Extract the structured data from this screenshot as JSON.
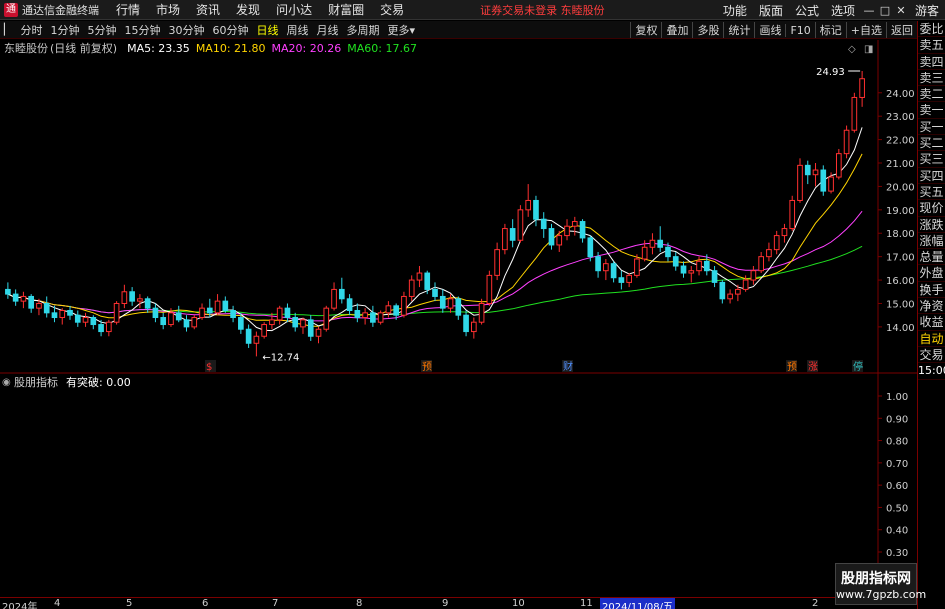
{
  "app": {
    "title": "通达信金融终端",
    "logo_text": "通"
  },
  "menu": [
    "行情",
    "市场",
    "资讯",
    "发现",
    "问小达",
    "财富圈",
    "交易"
  ],
  "login_warning": "证券交易未登录  东睦股份",
  "right_menu": [
    "功能",
    "版面",
    "公式",
    "选项"
  ],
  "user": "游客",
  "toolbar": {
    "periods": [
      "分时",
      "1分钟",
      "5分钟",
      "15分钟",
      "30分钟",
      "60分钟",
      "日线",
      "周线",
      "月线",
      "多周期",
      "更多"
    ],
    "active_period": "日线",
    "actions": [
      "复权",
      "叠加",
      "多股",
      "统计",
      "画线",
      "F10",
      "标记",
      "+自选",
      "返回"
    ]
  },
  "stock": {
    "name": "东睦股份",
    "mode": "(日线 前复权)"
  },
  "ma": [
    {
      "label": "MA5: 23.35",
      "color": "#ffffff"
    },
    {
      "label": "MA10: 21.80",
      "color": "#ffd400"
    },
    {
      "label": "MA20: 20.26",
      "color": "#ff40ff"
    },
    {
      "label": "MA60: 17.67",
      "color": "#20e020"
    }
  ],
  "price_axis": [
    "24.00",
    "23.00",
    "22.00",
    "21.00",
    "20.00",
    "19.00",
    "18.00",
    "17.00",
    "16.00",
    "15.00",
    "14.00"
  ],
  "annotations": {
    "high": "24.93",
    "low": "12.74"
  },
  "event_markers": [
    "$",
    "预",
    "财",
    "预",
    "涨",
    "停"
  ],
  "indicator": {
    "name": "股朋指标",
    "value": "有突破: 0.00"
  },
  "indicator_axis": [
    "1.00",
    "0.90",
    "0.80",
    "0.70",
    "0.60",
    "0.50",
    "0.40",
    "0.30"
  ],
  "right_panel": [
    "委比",
    "卖五",
    "卖四",
    "卖三",
    "卖二",
    "卖一",
    "买一",
    "买二",
    "买三",
    "买四",
    "买五",
    "现价",
    "涨跌",
    "涨幅",
    "总量",
    "外盘",
    "换手",
    "净资",
    "收益",
    "自动",
    "交易",
    "15:00"
  ],
  "date_axis": [
    "2024年",
    "4",
    "5",
    "6",
    "7",
    "8",
    "9",
    "10",
    "11",
    "2024/11/08/五",
    "2"
  ],
  "watermark": {
    "line1": "股朋指标网",
    "line2": "www.7gpzb.com"
  },
  "colors": {
    "up": "#ff3030",
    "down": "#30d8e8",
    "ma5": "#ffffff",
    "ma10": "#ffd400",
    "ma20": "#ff40ff",
    "ma60": "#20e020"
  },
  "chart_data": {
    "type": "candlestick",
    "price_range": [
      12.5,
      25.4
    ],
    "ohlc": [
      [
        15.6,
        15.9,
        15.2,
        15.4
      ],
      [
        15.4,
        15.6,
        14.9,
        15.1
      ],
      [
        15.1,
        15.5,
        14.8,
        15.3
      ],
      [
        15.3,
        15.4,
        14.6,
        14.8
      ],
      [
        14.8,
        15.2,
        14.5,
        15.0
      ],
      [
        15.0,
        15.3,
        14.4,
        14.6
      ],
      [
        14.6,
        14.9,
        14.2,
        14.4
      ],
      [
        14.4,
        14.8,
        14.1,
        14.7
      ],
      [
        14.7,
        14.9,
        14.3,
        14.5
      ],
      [
        14.5,
        14.7,
        14.0,
        14.2
      ],
      [
        14.2,
        14.6,
        14.0,
        14.4
      ],
      [
        14.4,
        14.5,
        13.9,
        14.1
      ],
      [
        14.1,
        14.3,
        13.6,
        13.8
      ],
      [
        13.8,
        14.3,
        13.6,
        14.2
      ],
      [
        14.2,
        15.1,
        14.1,
        15.0
      ],
      [
        15.0,
        15.8,
        14.8,
        15.5
      ],
      [
        15.5,
        15.7,
        14.9,
        15.1
      ],
      [
        15.1,
        15.4,
        14.8,
        15.2
      ],
      [
        15.2,
        15.3,
        14.6,
        14.8
      ],
      [
        14.8,
        15.0,
        14.2,
        14.4
      ],
      [
        14.4,
        14.6,
        13.9,
        14.1
      ],
      [
        14.1,
        14.8,
        14.0,
        14.6
      ],
      [
        14.6,
        14.9,
        14.2,
        14.3
      ],
      [
        14.3,
        14.5,
        13.8,
        14.0
      ],
      [
        14.0,
        14.5,
        13.9,
        14.4
      ],
      [
        14.4,
        15.0,
        14.3,
        14.8
      ],
      [
        14.8,
        15.2,
        14.4,
        14.6
      ],
      [
        14.6,
        15.4,
        14.5,
        15.1
      ],
      [
        15.1,
        15.3,
        14.6,
        14.7
      ],
      [
        14.7,
        14.9,
        14.2,
        14.4
      ],
      [
        14.4,
        14.6,
        13.7,
        13.9
      ],
      [
        13.9,
        14.1,
        13.1,
        13.3
      ],
      [
        13.3,
        13.8,
        12.74,
        13.6
      ],
      [
        13.6,
        14.2,
        13.5,
        14.1
      ],
      [
        14.1,
        14.6,
        13.9,
        14.3
      ],
      [
        14.3,
        14.9,
        14.1,
        14.8
      ],
      [
        14.8,
        15.0,
        14.2,
        14.4
      ],
      [
        14.4,
        14.6,
        13.8,
        14.0
      ],
      [
        14.0,
        14.4,
        13.7,
        14.3
      ],
      [
        14.3,
        14.5,
        13.4,
        13.6
      ],
      [
        13.6,
        14.0,
        13.3,
        13.9
      ],
      [
        13.9,
        14.9,
        13.8,
        14.8
      ],
      [
        14.8,
        15.9,
        14.7,
        15.6
      ],
      [
        15.6,
        16.1,
        15.0,
        15.2
      ],
      [
        15.2,
        15.4,
        14.5,
        14.7
      ],
      [
        14.7,
        15.0,
        14.2,
        14.4
      ],
      [
        14.4,
        14.8,
        14.1,
        14.6
      ],
      [
        14.6,
        14.9,
        14.0,
        14.2
      ],
      [
        14.2,
        14.7,
        14.1,
        14.6
      ],
      [
        14.6,
        15.1,
        14.4,
        14.9
      ],
      [
        14.9,
        15.0,
        14.3,
        14.5
      ],
      [
        14.5,
        15.5,
        14.4,
        15.3
      ],
      [
        15.3,
        16.2,
        15.1,
        16.0
      ],
      [
        16.0,
        16.6,
        15.7,
        16.3
      ],
      [
        16.3,
        16.4,
        15.4,
        15.6
      ],
      [
        15.6,
        15.9,
        15.1,
        15.3
      ],
      [
        15.3,
        15.6,
        14.6,
        14.8
      ],
      [
        14.8,
        15.4,
        14.6,
        15.2
      ],
      [
        15.2,
        15.3,
        14.3,
        14.5
      ],
      [
        14.5,
        14.7,
        13.6,
        13.8
      ],
      [
        13.8,
        14.4,
        13.5,
        14.2
      ],
      [
        14.2,
        15.2,
        14.1,
        15.0
      ],
      [
        15.0,
        16.4,
        14.9,
        16.2
      ],
      [
        16.2,
        17.6,
        16.0,
        17.3
      ],
      [
        17.3,
        18.4,
        17.1,
        18.2
      ],
      [
        18.2,
        18.6,
        17.4,
        17.7
      ],
      [
        17.7,
        19.2,
        17.6,
        19.0
      ],
      [
        19.0,
        20.1,
        18.7,
        19.4
      ],
      [
        19.4,
        19.6,
        18.3,
        18.6
      ],
      [
        18.6,
        18.9,
        17.8,
        18.2
      ],
      [
        18.2,
        18.4,
        17.3,
        17.5
      ],
      [
        17.5,
        18.1,
        17.2,
        17.9
      ],
      [
        17.9,
        18.6,
        17.7,
        18.3
      ],
      [
        18.3,
        18.7,
        17.9,
        18.5
      ],
      [
        18.5,
        18.6,
        17.6,
        17.8
      ],
      [
        17.8,
        17.9,
        16.8,
        17.0
      ],
      [
        17.0,
        17.2,
        16.1,
        16.4
      ],
      [
        16.4,
        16.9,
        16.0,
        16.7
      ],
      [
        16.7,
        16.8,
        15.9,
        16.1
      ],
      [
        16.1,
        16.4,
        15.6,
        15.9
      ],
      [
        15.9,
        16.3,
        15.7,
        16.2
      ],
      [
        16.2,
        17.1,
        16.1,
        16.9
      ],
      [
        16.9,
        17.7,
        16.8,
        17.4
      ],
      [
        17.4,
        18.0,
        17.1,
        17.7
      ],
      [
        17.7,
        18.3,
        17.2,
        17.4
      ],
      [
        17.4,
        17.6,
        16.8,
        17.0
      ],
      [
        17.0,
        17.2,
        16.4,
        16.6
      ],
      [
        16.6,
        16.8,
        16.1,
        16.3
      ],
      [
        16.3,
        16.6,
        15.9,
        16.4
      ],
      [
        16.4,
        17.0,
        16.2,
        16.8
      ],
      [
        16.8,
        17.1,
        16.2,
        16.4
      ],
      [
        16.4,
        16.6,
        15.7,
        15.9
      ],
      [
        15.9,
        16.0,
        15.0,
        15.2
      ],
      [
        15.2,
        15.6,
        15.0,
        15.4
      ],
      [
        15.4,
        15.8,
        15.1,
        15.6
      ],
      [
        15.6,
        16.2,
        15.5,
        16.0
      ],
      [
        16.0,
        16.6,
        15.8,
        16.4
      ],
      [
        16.4,
        17.2,
        16.3,
        17.0
      ],
      [
        17.0,
        17.6,
        16.8,
        17.3
      ],
      [
        17.3,
        18.1,
        17.1,
        17.9
      ],
      [
        17.9,
        18.4,
        17.6,
        18.2
      ],
      [
        18.2,
        19.6,
        18.1,
        19.4
      ],
      [
        19.4,
        21.2,
        19.3,
        20.9
      ],
      [
        20.9,
        21.1,
        20.1,
        20.5
      ],
      [
        20.5,
        21.0,
        20.0,
        20.7
      ],
      [
        20.7,
        20.9,
        19.6,
        19.8
      ],
      [
        19.8,
        20.6,
        19.7,
        20.4
      ],
      [
        20.4,
        21.6,
        20.3,
        21.4
      ],
      [
        21.4,
        22.6,
        21.2,
        22.4
      ],
      [
        22.4,
        24.0,
        22.3,
        23.8
      ],
      [
        23.8,
        24.93,
        23.4,
        24.6
      ]
    ]
  }
}
